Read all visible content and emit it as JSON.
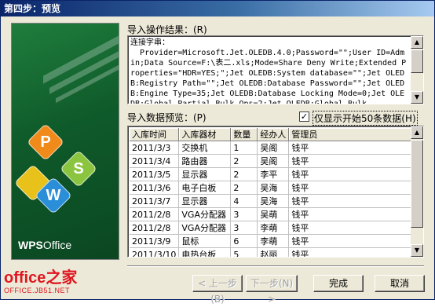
{
  "window": {
    "title": "第四步：预览",
    "close_glyph": "×"
  },
  "banner": {
    "logo_wps": "WPS",
    "logo_office": "Office",
    "tiles": [
      "P",
      "S",
      "W"
    ]
  },
  "result": {
    "label": "导入操作结果：(R)",
    "text": "连接字串：\n  Provider=Microsoft.Jet.OLEDB.4.0;Password=\"\";User ID=Admin;Data Source=F:\\表二.xls;Mode=Share Deny Write;Extended Properties=\"HDR=YES;\";Jet OLEDB:System database=\"\";Jet OLEDB:Registry Path=\"\";Jet OLEDB:Database Password=\"\";Jet OLEDB:Engine Type=35;Jet OLEDB:Database Locking Mode=0;Jet OLEDB:Global Partial Bulk Ops=2;Jet OLEDB:Global Bulk"
  },
  "preview": {
    "label": "导入数据预览：(P)",
    "checkbox_label": "仅显示开始50条数据(H)",
    "checkbox_checked": "✓",
    "columns": [
      "入库时间",
      "入库器材",
      "数量",
      "经办人",
      "管理员"
    ],
    "rows": [
      [
        "2011/3/3",
        "交换机",
        "1",
        "吴阁",
        "钱平"
      ],
      [
        "2011/3/4",
        "路由器",
        "2",
        "吴阁",
        "钱平"
      ],
      [
        "2011/3/5",
        "显示器",
        "2",
        "李平",
        "钱平"
      ],
      [
        "2011/3/6",
        "电子白板",
        "2",
        "吴海",
        "钱平"
      ],
      [
        "2011/3/7",
        "显示器",
        "4",
        "吴海",
        "钱平"
      ],
      [
        "2011/2/8",
        "VGA分配器",
        "3",
        "吴萌",
        "钱平"
      ],
      [
        "2011/2/8",
        "VGA分配器",
        "3",
        "李萌",
        "钱平"
      ],
      [
        "2011/3/9",
        "鼠标",
        "6",
        "李萌",
        "钱平"
      ],
      [
        "2011/3/10",
        "电热台板",
        "5",
        "赵丽",
        "钱平"
      ],
      [
        "2011/3/11",
        "键盘",
        "7",
        "吴海",
        "钱平"
      ]
    ]
  },
  "buttons": {
    "prev": "< 上一步(B)",
    "next": "下一步(N) >",
    "finish": "完成",
    "cancel": "取消"
  },
  "watermark": {
    "main": "office之家",
    "sub": "OFFICE.JB51.NET"
  }
}
